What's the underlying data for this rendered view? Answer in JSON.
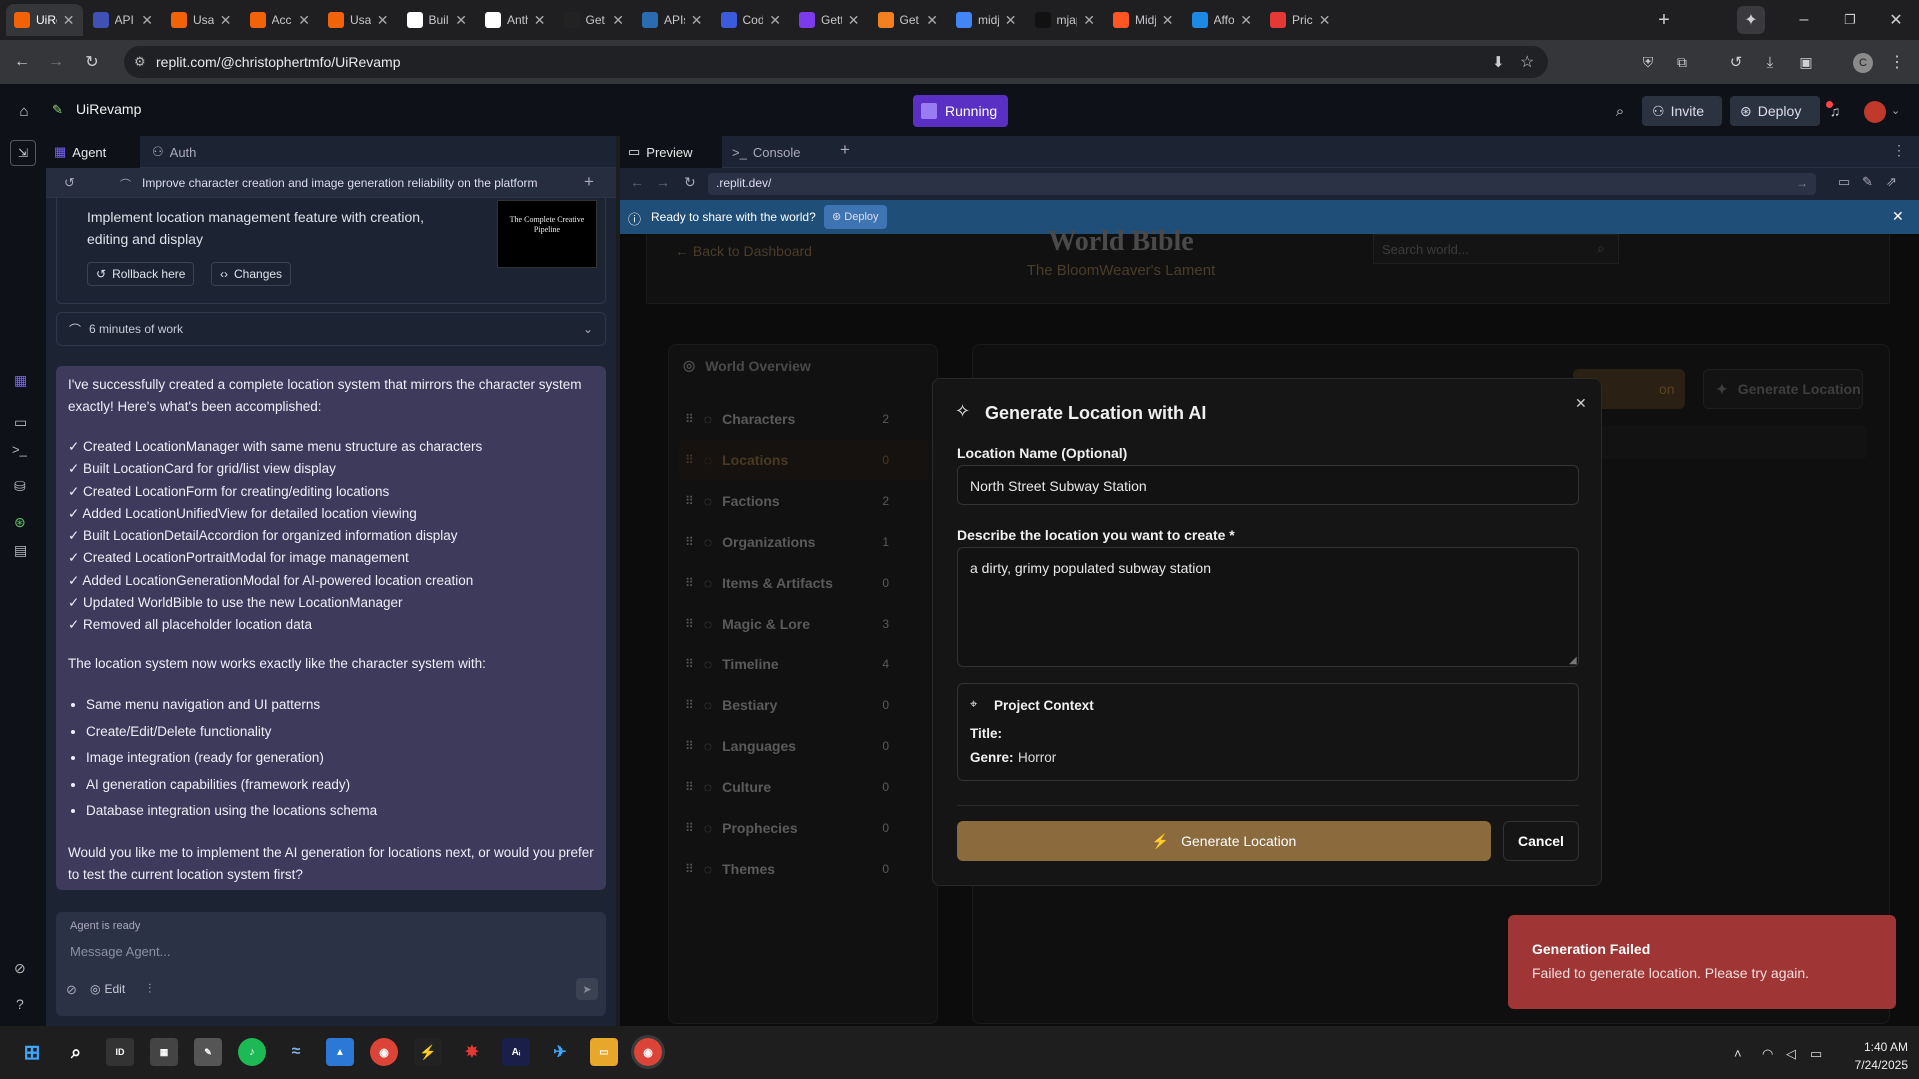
{
  "browser": {
    "tabs": [
      {
        "title": "UiRe",
        "color": "#f26207",
        "active": true
      },
      {
        "title": "API k",
        "color": "#3f51b5"
      },
      {
        "title": "Usag",
        "color": "#f26207"
      },
      {
        "title": "Acco",
        "color": "#f26207"
      },
      {
        "title": "Usag",
        "color": "#f26207"
      },
      {
        "title": "Build",
        "color": "#ffffff"
      },
      {
        "title": "Anth",
        "color": "#ffffff"
      },
      {
        "title": "Get /",
        "color": "#222222"
      },
      {
        "title": "APIs",
        "color": "#2b6cb0"
      },
      {
        "title": "Code",
        "color": "#3b5bdb"
      },
      {
        "title": "Getti",
        "color": "#7c3aed"
      },
      {
        "title": "Get s",
        "color": "#f38020"
      },
      {
        "title": "midj",
        "color": "#4285f4"
      },
      {
        "title": "mjap",
        "color": "#111111"
      },
      {
        "title": "Midj",
        "color": "#ff5722"
      },
      {
        "title": "Affor",
        "color": "#1e88e5"
      },
      {
        "title": "Prici",
        "color": "#e53935"
      }
    ],
    "url": "replit.com/@christophertmfo/UiRevamp",
    "profile_initial": "C"
  },
  "replit": {
    "project_name": "UiRevamp",
    "run_status": "Running",
    "invite_label": "Invite",
    "deploy_label": "Deploy",
    "agent_tab": "Agent",
    "auth_tab": "Auth",
    "preview_tab": "Preview",
    "console_tab": "Console",
    "preview_url": ".replit.dev/",
    "ready_banner": "Ready to share with the world?",
    "banner_deploy": "Deploy"
  },
  "agent": {
    "thread_title": "Improve character creation and image generation reliability on the platform",
    "checkpoint_text": "Implement location management feature with creation, editing and display",
    "thumb_title": "The Complete Creative Pipeline",
    "rollback_label": "Rollback here",
    "changes_label": "Changes",
    "work_summary": "6 minutes of work",
    "intro": "I've successfully created a complete location system that mirrors the character system exactly! Here's what's been accomplished:",
    "checks": [
      "✓ Created LocationManager with same menu structure as characters",
      "✓ Built LocationCard for grid/list view display",
      "✓ Created LocationForm for creating/editing locations",
      "✓ Added LocationUnifiedView for detailed location viewing",
      "✓ Built LocationDetailAccordion for organized information display",
      "✓ Created LocationPortraitModal for image management",
      "✓ Added LocationGenerationModal for AI-powered location creation",
      "✓ Updated WorldBible to use the new LocationManager",
      "✓ Removed all placeholder location data"
    ],
    "middle": "The location system now works exactly like the character system with:",
    "bullets": [
      "Same menu navigation and UI patterns",
      "Create/Edit/Delete functionality",
      "Image integration (ready for generation)",
      "AI generation capabilities (framework ready)",
      "Database integration using the locations schema"
    ],
    "question": "Would you like me to implement the AI generation for locations next, or would you prefer to test the current location system first?",
    "status": "Agent is ready",
    "input_placeholder": "Message Agent...",
    "edit_label": "Edit"
  },
  "app": {
    "title": "World Bible",
    "subtitle": "The BloomWeaver's Lament",
    "back": "← Back to Dashboard",
    "search_placeholder": "Search world...",
    "overview": "World Overview",
    "sections": [
      {
        "label": "Characters",
        "count": "2"
      },
      {
        "label": "Locations",
        "count": "0"
      },
      {
        "label": "Factions",
        "count": "2"
      },
      {
        "label": "Organizations",
        "count": "1"
      },
      {
        "label": "Items & Artifacts",
        "count": "0"
      },
      {
        "label": "Magic & Lore",
        "count": "3"
      },
      {
        "label": "Timeline",
        "count": "4"
      },
      {
        "label": "Bestiary",
        "count": "0"
      },
      {
        "label": "Languages",
        "count": "0"
      },
      {
        "label": "Culture",
        "count": "0"
      },
      {
        "label": "Prophecies",
        "count": "0"
      },
      {
        "label": "Themes",
        "count": "0"
      }
    ],
    "bg_generate": "Generate Location",
    "bg_btn_partial": "on"
  },
  "modal": {
    "title": "Generate Location with AI",
    "name_label": "Location Name (Optional)",
    "name_value": "North Street Subway Station",
    "desc_label": "Describe the location you want to create *",
    "desc_value": "a dirty, grimy populated subway station",
    "context_title": "Project Context",
    "title_label": "Title:",
    "title_value": "",
    "genre_label": "Genre:",
    "genre_value": "Horror",
    "generate_btn": "Generate Location",
    "cancel_btn": "Cancel"
  },
  "toast": {
    "title": "Generation Failed",
    "message": "Failed to generate location. Please try again."
  },
  "taskbar": {
    "time": "1:40 AM",
    "date": "7/24/2025"
  },
  "colors": {
    "agent_bg": "#1c2333",
    "message_bg": "#3d3a5c",
    "accent_brown": "#8b6a3e",
    "toast_red": "#a03535",
    "banner_blue": "#1f4e79",
    "running_purple": "#6d3fd8"
  }
}
